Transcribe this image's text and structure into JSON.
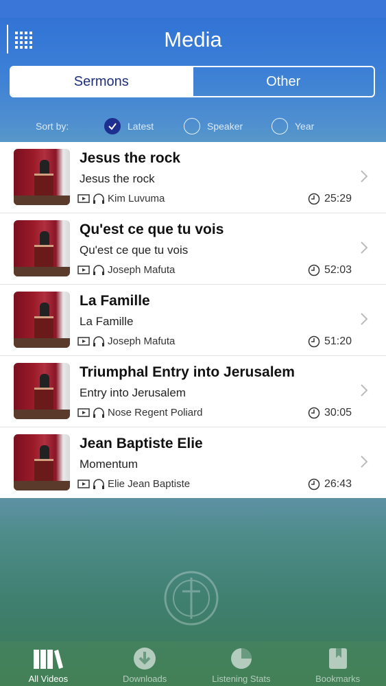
{
  "header": {
    "title": "Media"
  },
  "tabs": [
    {
      "label": "Sermons"
    },
    {
      "label": "Other"
    }
  ],
  "sort": {
    "label": "Sort by:",
    "options": [
      {
        "label": "Latest",
        "selected": true
      },
      {
        "label": "Speaker",
        "selected": false
      },
      {
        "label": "Year",
        "selected": false
      }
    ]
  },
  "items": [
    {
      "title": "Jesus the rock",
      "subtitle": "Jesus the rock",
      "speaker": "Kim Luvuma",
      "duration": "25:29"
    },
    {
      "title": "Qu'est ce que tu vois",
      "subtitle": "Qu'est ce que tu vois",
      "speaker": "Joseph Mafuta",
      "duration": "52:03"
    },
    {
      "title": "La Famille",
      "subtitle": "La Famille",
      "speaker": "Joseph Mafuta",
      "duration": "51:20"
    },
    {
      "title": "Triumphal Entry into Jerusalem",
      "subtitle": "Entry into Jerusalem",
      "speaker": "Nose Regent Poliard",
      "duration": "30:05"
    },
    {
      "title": "Jean Baptiste Elie",
      "subtitle": "Momentum",
      "speaker": "Elie Jean Baptiste",
      "duration": "26:43"
    }
  ],
  "tabbar": [
    {
      "label": "All Videos",
      "icon": "books-icon"
    },
    {
      "label": "Downloads",
      "icon": "download-icon"
    },
    {
      "label": "Listening Stats",
      "icon": "pie-chart-icon"
    },
    {
      "label": "Bookmarks",
      "icon": "bookmark-icon"
    }
  ],
  "colors": {
    "accent": "#1e2f8f",
    "header_top": "#3a76d8"
  }
}
